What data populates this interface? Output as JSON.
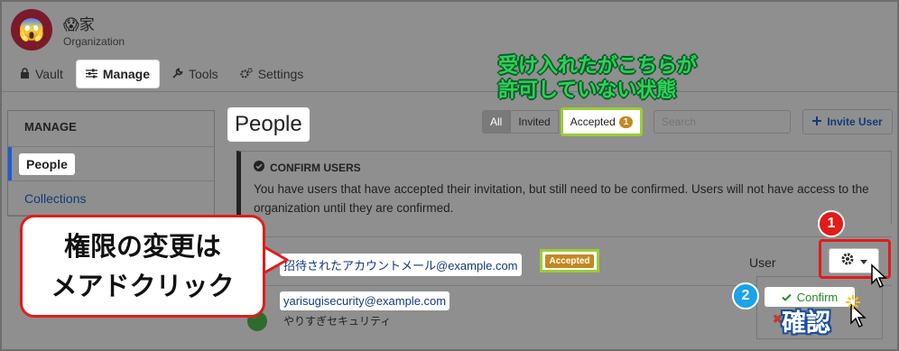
{
  "org": {
    "emoji": "😱",
    "name": "😱家",
    "subtitle": "Organization"
  },
  "nav": {
    "tabs": [
      {
        "icon": "🔒",
        "label": "Vault"
      },
      {
        "icon": "⚙",
        "label": "Manage"
      },
      {
        "icon": "🔧",
        "label": "Tools"
      },
      {
        "icon": "⚙",
        "label": "Settings"
      }
    ]
  },
  "sidebar": {
    "heading": "MANAGE",
    "items": [
      {
        "label": "People"
      },
      {
        "label": "Collections"
      }
    ]
  },
  "main": {
    "title": "People",
    "filters": {
      "all": "All",
      "invited": "Invited",
      "accepted": "Accepted",
      "accepted_count": "1"
    },
    "search_placeholder": "Search",
    "invite_label": "Invite User"
  },
  "confirm_callout": {
    "heading": "CONFIRM USERS",
    "body": "You have users that have accepted their invitation, but still need to be confirmed. Users will not have access to the organization until they are confirmed."
  },
  "rows": [
    {
      "email": "招待されたアカウントメール@example.com",
      "status": "Accepted",
      "type": "User"
    },
    {
      "email": "yarisugisecurity@example.com",
      "name": "やりすぎセキュリティ"
    }
  ],
  "menu": {
    "confirm_label": "Confirm",
    "remove_icon": "✖"
  },
  "annotations": {
    "green_line1": "受け入れたがこちらが",
    "green_line2": "許可していない状態",
    "callout_line1": "権限の変更は",
    "callout_line2": "メアドクリック",
    "badge1": "1",
    "badge2": "2",
    "kakunin": "確認"
  },
  "colors": {
    "accent": "#175ddc",
    "highlight_red": "#e31b1b",
    "highlight_green": "#9acd32",
    "accepted_badge": "#c7871f"
  }
}
